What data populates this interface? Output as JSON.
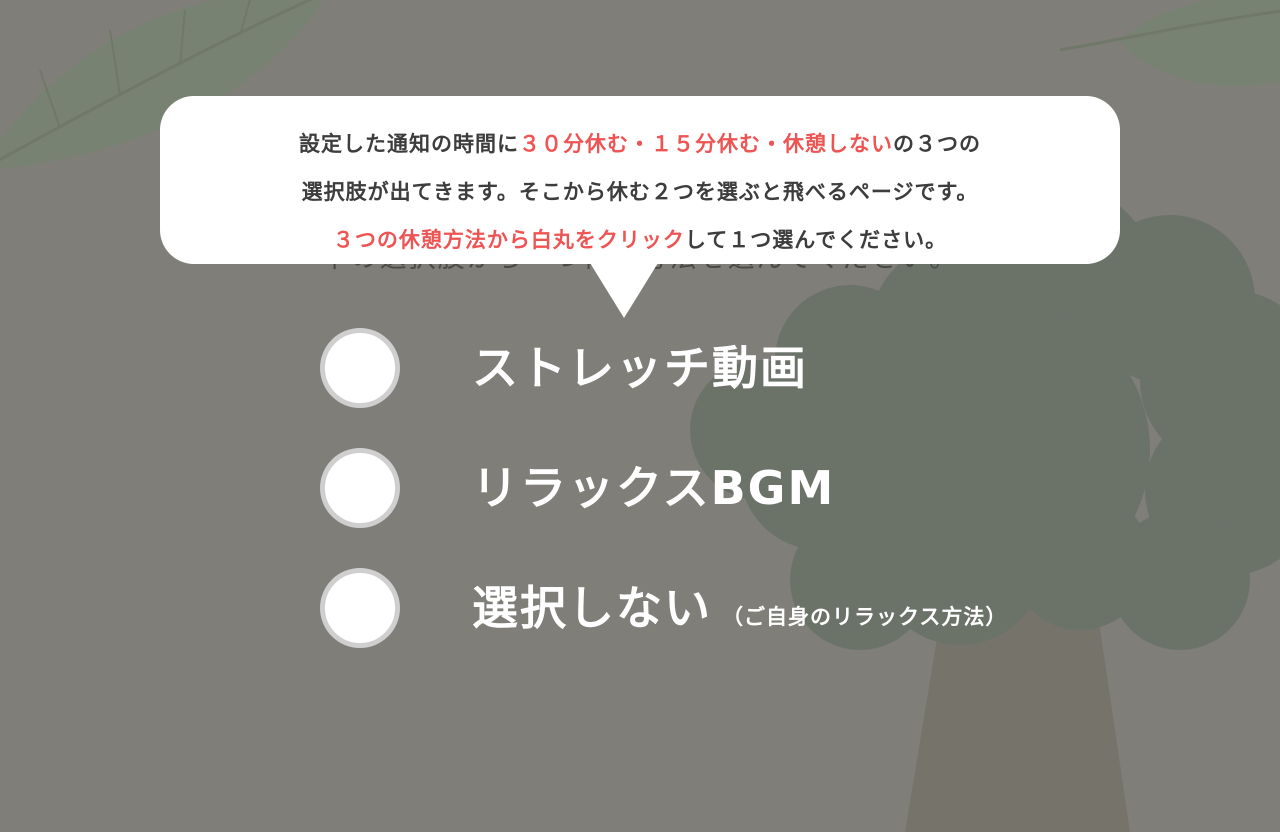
{
  "subtitle": "下の選択肢から一つ休憩方法を選んでください。",
  "tooltip": {
    "line1_pre": "設定した通知の時間に",
    "line1_highlight": "３０分休む・１５分休む・休憩しない",
    "line1_post": "の３つの",
    "line2": "選択肢が出てきます。そこから休む２つを選ぶと飛べるページです。",
    "line3_highlight": "３つの休憩方法から白丸をクリック",
    "line3_post": "して１つ選んでください。"
  },
  "options": [
    {
      "label": "ストレッチ動画",
      "note": ""
    },
    {
      "label": "リラックスBGM",
      "note": ""
    },
    {
      "label": "選択しない",
      "note": "（ご自身のリラックス方法）"
    }
  ],
  "colors": {
    "overlay_bg": "#7f7e79",
    "highlight": "#ee5454",
    "tooltip_bg": "#ffffff",
    "option_text": "#ffffff"
  }
}
